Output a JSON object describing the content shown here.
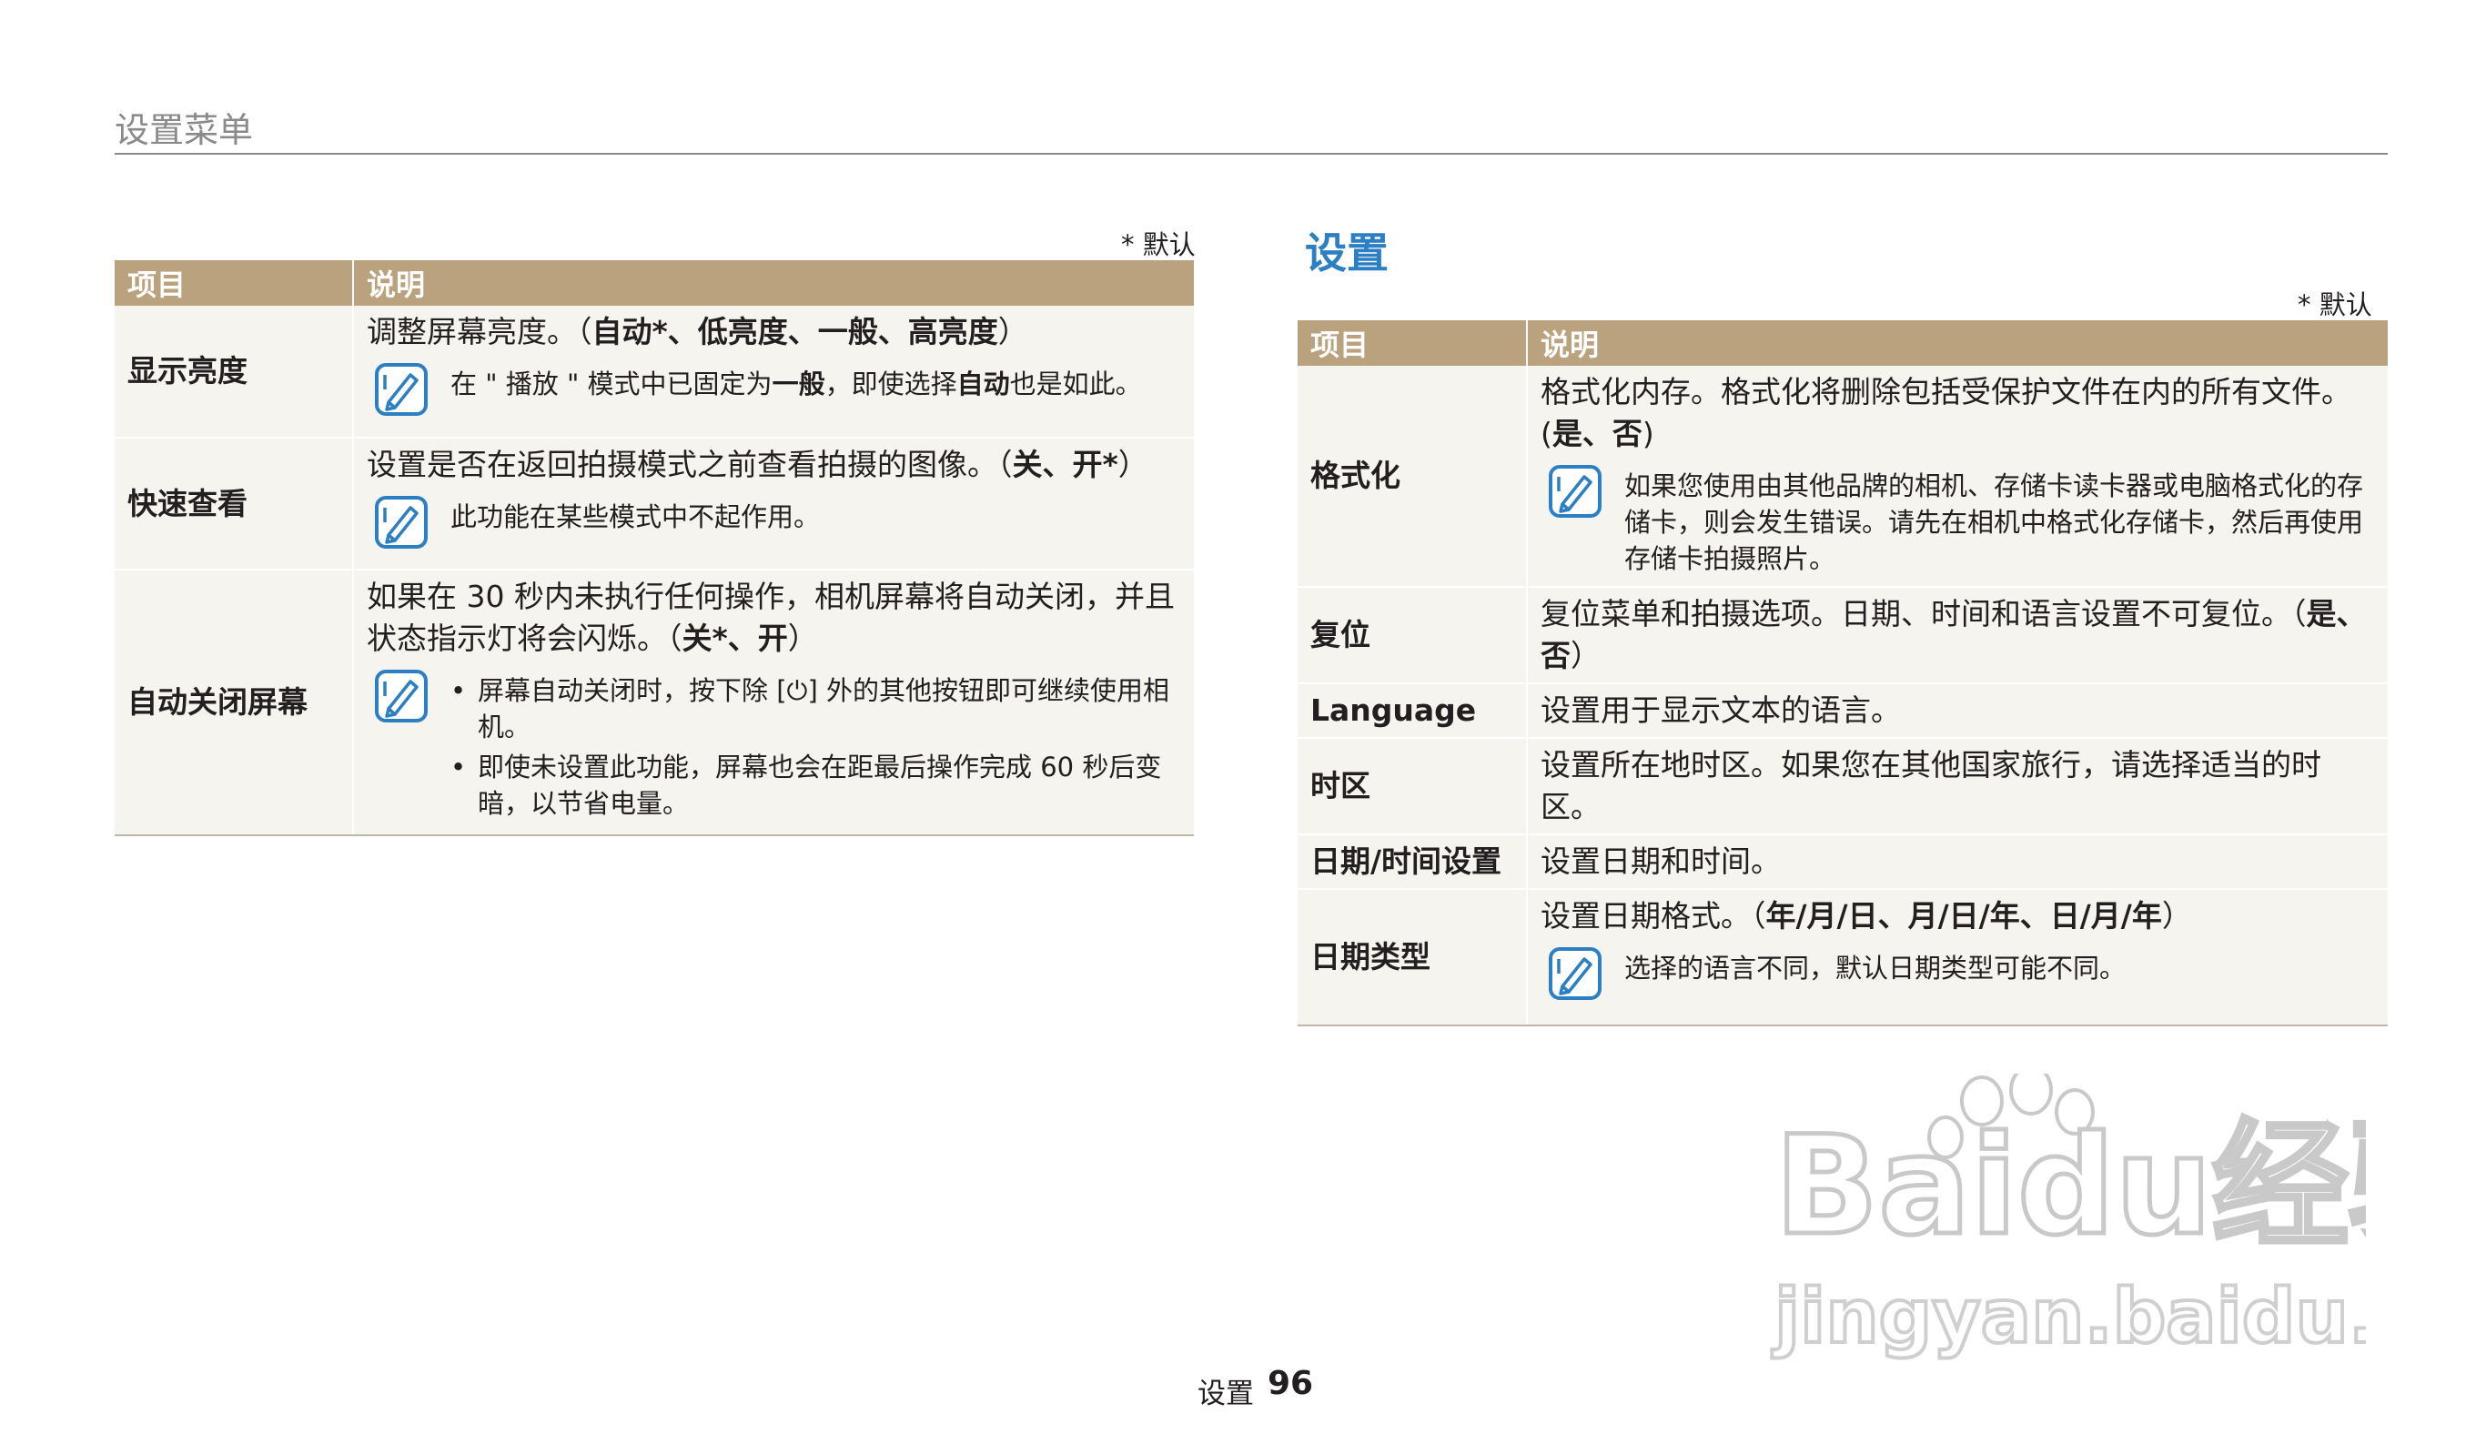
{
  "header": {
    "title": "设置菜单"
  },
  "left": {
    "default_note": "* 默认",
    "columns": [
      "项目",
      "说明"
    ],
    "rows": [
      {
        "item": "显示亮度",
        "desc_prefix": "调整屏幕亮度。（",
        "desc_options": "自动*、低亮度、一般、高亮度",
        "desc_suffix": "）",
        "note_a": "在 \" 播放 \" 模式中已固定为",
        "note_b": "一般",
        "note_c": "，即使选择",
        "note_d": "自动",
        "note_e": "也是如此。"
      },
      {
        "item": "快速查看",
        "desc_prefix": "设置是否在返回拍摄模式之前查看拍摄的图像。（",
        "desc_options": "关、开*",
        "desc_suffix": "）",
        "note": "此功能在某些模式中不起作用。"
      },
      {
        "item": "自动关闭屏幕",
        "desc_prefix": "如果在 30 秒内未执行任何操作，相机屏幕将自动关闭，并且状态指示灯将会闪烁。（",
        "desc_options": "关*、开",
        "desc_suffix": "）",
        "bullets": [
          "屏幕自动关闭时，按下除 [⏻] 外的其他按钮即可继续使用相机。",
          "即使未设置此功能，屏幕也会在距最后操作完成 60 秒后变暗，以节省电量。"
        ]
      }
    ]
  },
  "right": {
    "section_title": "设置",
    "default_note": "* 默认",
    "columns": [
      "项目",
      "说明"
    ],
    "rows": [
      {
        "item": "格式化",
        "desc_prefix": "格式化内存。格式化将删除包括受保护文件在内的所有文件。(",
        "desc_options": "是、否",
        "desc_suffix": ")",
        "note": "如果您使用由其他品牌的相机、存储卡读卡器或电脑格式化的存储卡，则会发生错误。请先在相机中格式化存储卡，然后再使用存储卡拍摄照片。"
      },
      {
        "item": "复位",
        "desc_prefix": "复位菜单和拍摄选项。日期、时间和语言设置不可复位。（",
        "desc_options": "是、否",
        "desc_suffix": "）"
      },
      {
        "item": "Language",
        "desc": "设置用于显示文本的语言。"
      },
      {
        "item": "时区",
        "desc": "设置所在地时区。如果您在其他国家旅行，请选择适当的时区。"
      },
      {
        "item": "日期/时间设置",
        "desc": "设置日期和时间。"
      },
      {
        "item": "日期类型",
        "desc_prefix": "设置日期格式。（",
        "desc_options": "年/月/日、月/日/年、日/月/年",
        "desc_suffix": "）",
        "note": "选择的语言不同，默认日期类型可能不同。"
      }
    ]
  },
  "footer": {
    "label": "设置",
    "page_number": "96"
  },
  "watermark": {
    "brand": "Baidu经验",
    "url": "jingyan.baidu.com"
  },
  "colors": {
    "table_header": "#b9a27d",
    "row_bg": "#f6f4ef",
    "title_blue": "#2b7fc2",
    "note_icon": "#2b7fc2"
  }
}
